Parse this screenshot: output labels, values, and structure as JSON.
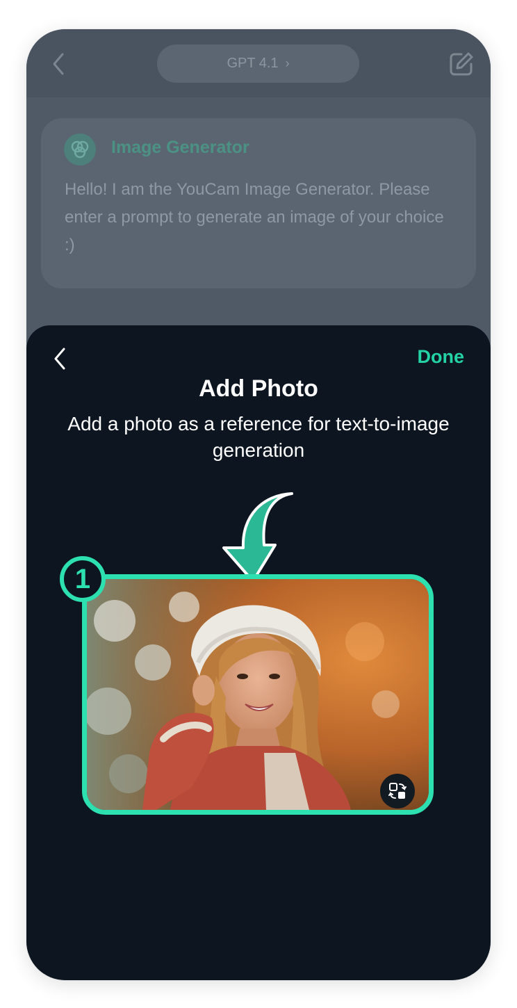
{
  "header": {
    "model_label": "GPT 4.1",
    "model_chevron": "›"
  },
  "message": {
    "bot_name": "Image Generator",
    "text": "Hello! I am the YouCam Image Generator. Please enter a prompt to generate an image of your choice :)"
  },
  "sheet": {
    "done_label": "Done",
    "title": "Add Photo",
    "subtitle": "Add a photo as a reference for text-to-image generation",
    "step_number": "1"
  },
  "icons": {
    "back": "chevron-left-icon",
    "edit": "edit-icon",
    "bot": "image-generator-logo-icon",
    "swap": "swap-photo-icon"
  },
  "colors": {
    "accent": "#2de0b0",
    "sheet_bg": "#0d1620",
    "dimmed_bg": "#4f5a66"
  }
}
